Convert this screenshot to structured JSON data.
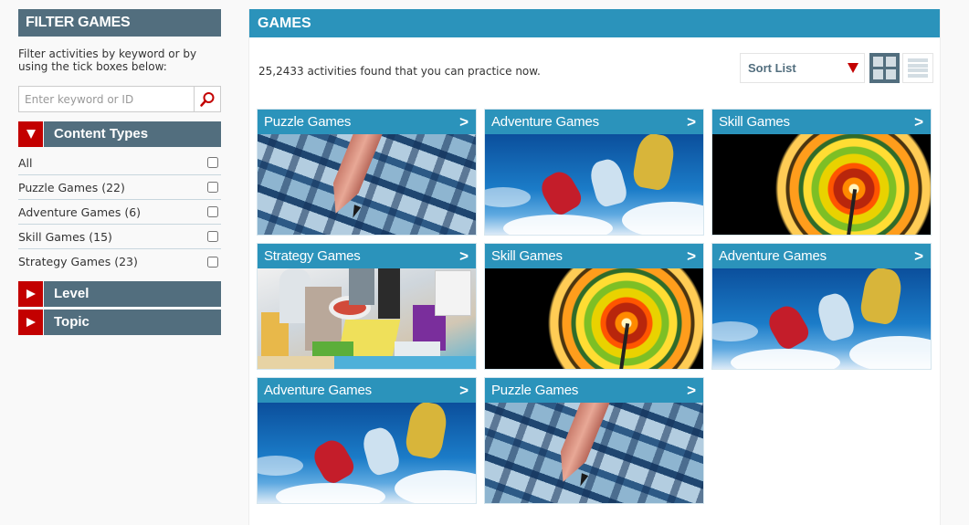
{
  "sidebar": {
    "title": "FILTER GAMES",
    "intro": "Filter activities by keyword or by using the tick boxes below:",
    "search": {
      "placeholder": "Enter keyword or ID",
      "value": "",
      "icon": "search-icon"
    },
    "sections": [
      {
        "label": "Content Types",
        "expanded": true,
        "items": [
          {
            "label": "All",
            "checked": false
          },
          {
            "label": "Puzzle Games (22)",
            "checked": false
          },
          {
            "label": "Adventure Games (6)",
            "checked": false
          },
          {
            "label": "Skill Games (15)",
            "checked": false
          },
          {
            "label": "Strategy Games (23)",
            "checked": false
          }
        ]
      },
      {
        "label": "Level",
        "expanded": false
      },
      {
        "label": "Topic",
        "expanded": false
      }
    ]
  },
  "main": {
    "title": "GAMES",
    "result_text": "25,2433 activities found that you can practice now.",
    "sort": {
      "label": "Sort List"
    },
    "view_modes": {
      "grid_active": true,
      "list_active": false
    },
    "cards": [
      {
        "title": "Puzzle Games",
        "arrow": ">",
        "image": "puzzle"
      },
      {
        "title": "Adventure Games",
        "arrow": ">",
        "image": "adventure"
      },
      {
        "title": "Skill Games",
        "arrow": ">",
        "image": "skill"
      },
      {
        "title": "Strategy Games",
        "arrow": ">",
        "image": "strategy"
      },
      {
        "title": "Skill Games",
        "arrow": ">",
        "image": "skill"
      },
      {
        "title": "Adventure Games",
        "arrow": ">",
        "image": "adventure"
      },
      {
        "title": "Adventure Games",
        "arrow": ">",
        "image": "adventure"
      },
      {
        "title": "Puzzle Games",
        "arrow": ">",
        "image": "puzzle"
      }
    ]
  },
  "colors": {
    "sidebar_header": "#526e7e",
    "main_header": "#2b93bb",
    "toggle_red": "#c30000"
  }
}
